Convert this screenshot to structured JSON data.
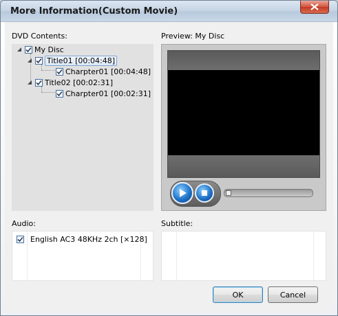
{
  "window": {
    "title": "More Information(Custom Movie)"
  },
  "labels": {
    "dvd_contents": "DVD Contents:",
    "preview": "Preview: My Disc",
    "audio": "Audio:",
    "subtitle": "Subtitle:"
  },
  "tree": {
    "root": {
      "label": "My Disc",
      "checked": true,
      "expanded": true
    },
    "titles": [
      {
        "label": "Title01 [00:04:48]",
        "checked": true,
        "expanded": true,
        "selected": true,
        "chapters": [
          {
            "label": "Charpter01 [00:04:48]",
            "checked": true
          }
        ]
      },
      {
        "label": "Title02 [00:02:31]",
        "checked": true,
        "expanded": true,
        "selected": false,
        "chapters": [
          {
            "label": "Charpter01 [00:02:31]",
            "checked": true
          }
        ]
      }
    ]
  },
  "audio": {
    "items": [
      {
        "label": "English AC3 48KHz 2ch [×128]",
        "checked": true
      }
    ]
  },
  "subtitle": {
    "items": []
  },
  "player": {
    "progress": 0
  },
  "buttons": {
    "ok": "OK",
    "cancel": "Cancel"
  }
}
